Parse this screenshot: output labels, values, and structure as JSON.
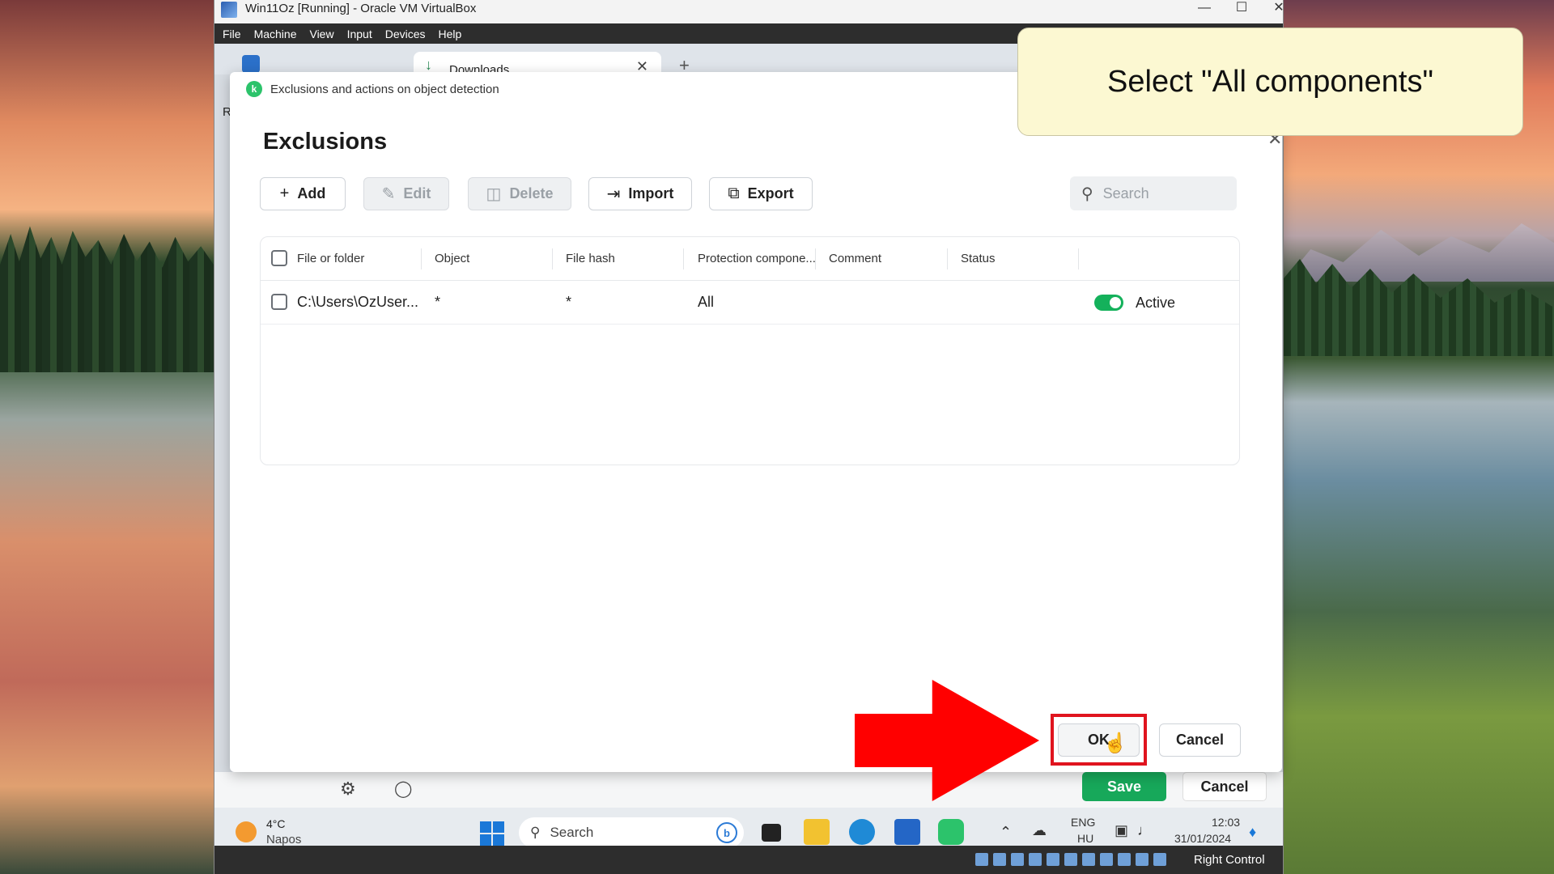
{
  "vbox": {
    "title": "Win11Oz [Running] - Oracle VM VirtualBox",
    "menu": [
      "File",
      "Machine",
      "View",
      "Input",
      "Devices",
      "Help"
    ],
    "status_right": "Right Control"
  },
  "browser": {
    "tab_label": "Downloads",
    "side_letter": "R"
  },
  "dialog": {
    "header": "Exclusions and actions on object detection",
    "title": "Exclusions",
    "toolbar": {
      "add": "Add",
      "edit": "Edit",
      "delete": "Delete",
      "import": "Import",
      "export": "Export"
    },
    "search_placeholder": "Search",
    "columns": [
      "File or folder",
      "Object",
      "File hash",
      "Protection compone...",
      "Comment",
      "Status"
    ],
    "rows": [
      {
        "file_or_folder": "C:\\Users\\OzUser...",
        "object": "*",
        "file_hash": "*",
        "protection_component": "All",
        "comment": "",
        "status": "Active"
      }
    ],
    "ok_label": "OK",
    "cancel_label": "Cancel"
  },
  "underlying": {
    "save_label": "Save",
    "cancel_label": "Cancel"
  },
  "taskbar": {
    "weather_temp": "4°C",
    "weather_desc": "Napos",
    "search_label": "Search",
    "lang_top": "ENG",
    "lang_bottom": "HU",
    "time": "12:03",
    "date": "31/01/2024"
  },
  "tutorial": {
    "callout_text": "Select \"All components\""
  },
  "colors": {
    "accent_green": "#14b15b",
    "save_green": "#17a85a",
    "highlight_red": "#e0141e",
    "callout_bg": "#fcf8d2"
  }
}
